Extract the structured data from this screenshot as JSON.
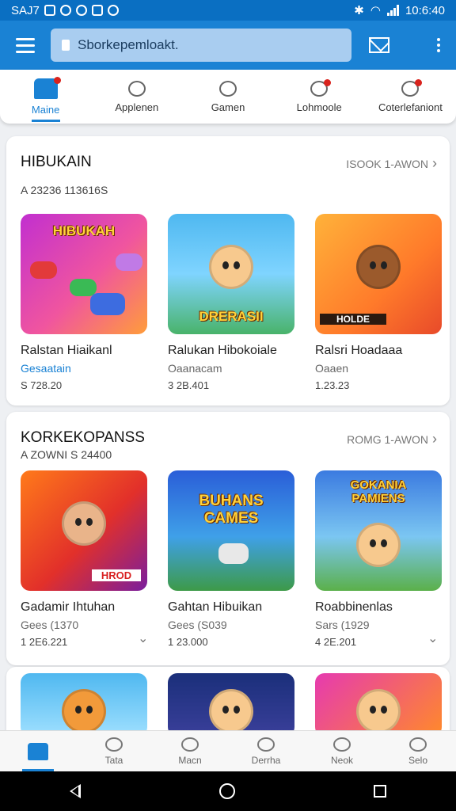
{
  "status": {
    "left": "SAJ7",
    "time": "10:6:40"
  },
  "appbar": {
    "search_text": "Sborkepemloakt."
  },
  "tabs": [
    {
      "label": "Maine",
      "badge": true
    },
    {
      "label": "Applenen",
      "badge": false
    },
    {
      "label": "Gamen",
      "badge": false
    },
    {
      "label": "Lohmoole",
      "badge": true
    },
    {
      "label": "Coterlefaniont",
      "badge": true
    }
  ],
  "sections": [
    {
      "title": "HIBUKAIN",
      "subtitle": "A 23236 113616S",
      "see_all": "ISOOK 1-AWON",
      "items": [
        {
          "name": "Ralstan Hiaikanl",
          "category": "Gesaatain",
          "price": "S 728.20",
          "banner": "HIBUKAH"
        },
        {
          "name": "Ralukan Hibokoiale",
          "category": "Oaanacam",
          "price": "3 2B.401",
          "banner": "DRERASII"
        },
        {
          "name": "Ralsri Hoadaaa",
          "category": "Oaaen",
          "price": "1.23.23",
          "banner": "HOLDE"
        }
      ]
    },
    {
      "title": "KORKEKOPANSS",
      "subtitle": "A ZOWNI S 24400",
      "see_all": "ROMG 1-AWON",
      "items": [
        {
          "name": "Gadamir Ihtuhan",
          "category": "Gees (1370",
          "price": "1 2E6.221",
          "banner": "HROD"
        },
        {
          "name": "Gahtan Hibuikan",
          "category": "Gees (S039",
          "price": "1 23.000",
          "banner": "BUHANS CAMES"
        },
        {
          "name": "Roabbinenlas",
          "category": "Sars (1929",
          "price": "4 2E.201",
          "banner": "GOKANIA PAMIENS"
        }
      ]
    }
  ],
  "bottom_nav": [
    "",
    "Tata",
    "Macn",
    "Derrha",
    "Neok",
    "Selo"
  ],
  "colors": {
    "primary": "#1a82d4",
    "status_bar": "#0a6fc2",
    "badge": "#d9231d"
  }
}
